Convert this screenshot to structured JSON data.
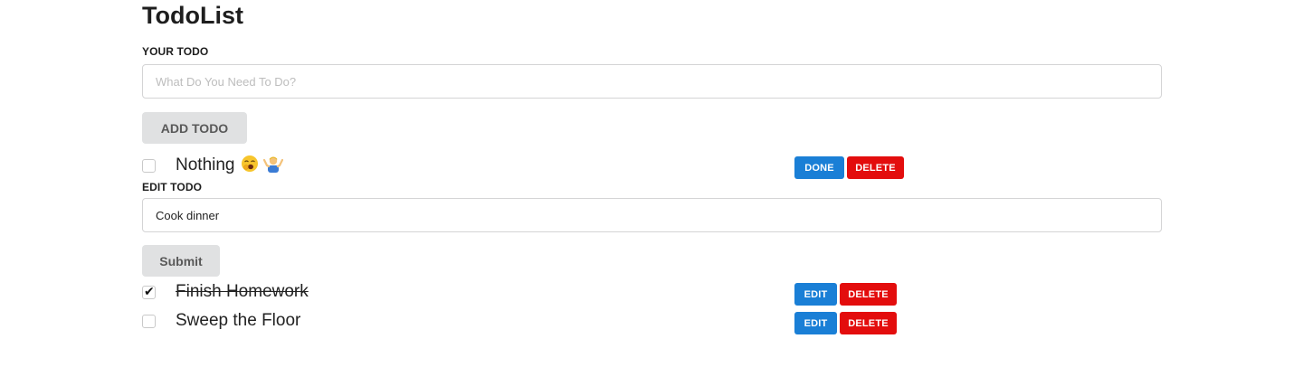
{
  "app": {
    "title": "TodoList"
  },
  "add_form": {
    "label": "YOUR TODO",
    "placeholder": "What Do You Need To Do?",
    "value": "",
    "submit_label": "ADD TODO"
  },
  "todos": [
    {
      "text": "Nothing",
      "emoji": [
        "yawning-face-emoji",
        "person-shrugging-emoji"
      ],
      "checked": false,
      "primary_action": "DONE",
      "delete_label": "DELETE",
      "editing": true
    },
    {
      "text": "Finish Homework",
      "checked": true,
      "primary_action": "EDIT",
      "delete_label": "DELETE",
      "editing": false
    },
    {
      "text": "Sweep the Floor",
      "checked": false,
      "primary_action": "EDIT",
      "delete_label": "DELETE",
      "editing": false
    }
  ],
  "edit_form": {
    "label": "EDIT TODO",
    "value": "Cook dinner",
    "submit_label": "Submit"
  },
  "colors": {
    "primary_button": "#1a7fd6",
    "danger_button": "#e30d0d",
    "grey_button": "#e0e1e2",
    "input_border": "#d4d4d5"
  }
}
